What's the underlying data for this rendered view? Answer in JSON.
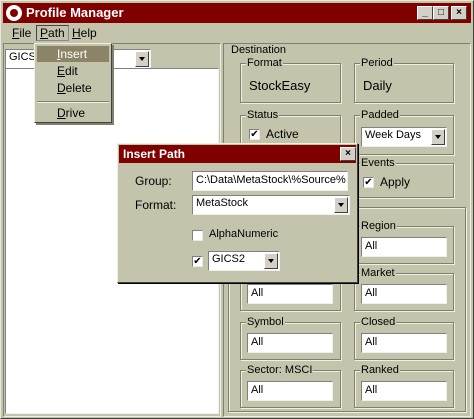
{
  "window": {
    "title": "Profile Manager",
    "app_icon": "profile-manager-icon"
  },
  "title_buttons": {
    "minimize": "_",
    "maximize": "□",
    "close": "×"
  },
  "menubar": {
    "file": {
      "key": "F",
      "rest": "ile"
    },
    "path": {
      "key": "P",
      "rest": "ath"
    },
    "help": {
      "key": "H",
      "rest": "elp"
    }
  },
  "path_menu": [
    {
      "key": "I",
      "rest": "nsert",
      "highlighted": true
    },
    {
      "key": "E",
      "rest": "dit"
    },
    {
      "key": "D",
      "rest": "elete"
    },
    {
      "key": "D",
      "rest": "rive"
    }
  ],
  "left": {
    "combo_value": "GICS2"
  },
  "destination": {
    "label": "Destination",
    "format": {
      "label": "Format",
      "value": "StockEasy"
    },
    "period": {
      "label": "Period",
      "value": "Daily"
    },
    "status": {
      "label": "Status",
      "checkbox_label": "Active",
      "checked": true
    },
    "padded": {
      "label": "Padded",
      "value": "Week Days"
    },
    "events": {
      "label": "Events",
      "checkbox_label": "Apply",
      "checked": true
    }
  },
  "filters": {
    "region": {
      "label": "Region",
      "value": "All"
    },
    "left_a": {
      "value": "All"
    },
    "market": {
      "label": "Market",
      "value": "All"
    },
    "symbol": {
      "label": "Symbol",
      "value": "All"
    },
    "closed": {
      "label": "Closed",
      "value": "All"
    },
    "sector": {
      "label": "Sector: MSCI",
      "value": "All"
    },
    "ranked": {
      "label": "Ranked",
      "value": "All"
    }
  },
  "dialog": {
    "title": "Insert Path",
    "group_label": "Group:",
    "group_value": "C:\\Data\\MetaStock\\%Source%",
    "format_label": "Format:",
    "format_value": "MetaStock",
    "alnum_label": "AlphaNumeric",
    "alnum_checked": false,
    "gics_checked": true,
    "gics_value": "GICS2",
    "close": "×"
  }
}
